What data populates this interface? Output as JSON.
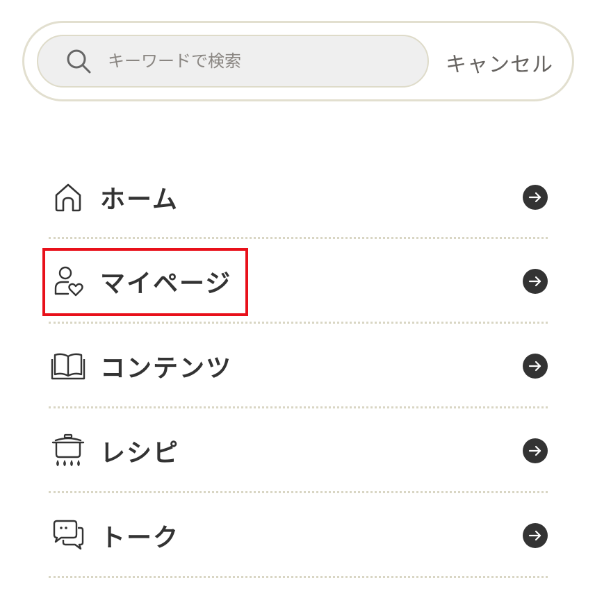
{
  "search": {
    "placeholder": "キーワードで検索",
    "value": "",
    "cancel_label": "キャンセル",
    "icon": "search-icon"
  },
  "menu": {
    "items": [
      {
        "label": "ホーム",
        "icon": "home-icon"
      },
      {
        "label": "マイページ",
        "icon": "user-heart-icon"
      },
      {
        "label": "コンテンツ",
        "icon": "book-icon"
      },
      {
        "label": "レシピ",
        "icon": "cooking-pot-icon"
      },
      {
        "label": "トーク",
        "icon": "chat-bubbles-icon"
      }
    ],
    "arrow_icon": "arrow-right-circle-icon",
    "highlighted_item": "マイページ"
  },
  "colors": {
    "text": "#333333",
    "border": "#e2dfcf",
    "search_bg": "#efefef",
    "divider": "#d9d6c4",
    "highlight": "#e8101a"
  }
}
